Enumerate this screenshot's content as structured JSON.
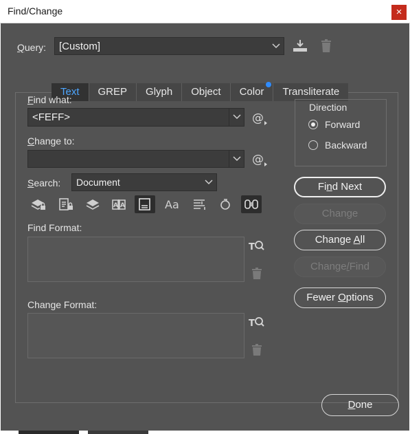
{
  "window": {
    "title": "Find/Change",
    "close_glyph": "×"
  },
  "query": {
    "label_prefix": "",
    "label_key": "Q",
    "label_rest": "uery:",
    "value": "[Custom]"
  },
  "tabs": [
    {
      "label": "Text",
      "active": true
    },
    {
      "label": "GREP"
    },
    {
      "label": "Glyph"
    },
    {
      "label": "Object"
    },
    {
      "label": "Color",
      "indicator": true
    },
    {
      "label": "Transliterate"
    }
  ],
  "find_what": {
    "label_key": "F",
    "label_rest": "ind what:",
    "value": "<FEFF>"
  },
  "change_to": {
    "label_key": "C",
    "label_rest": "hange to:",
    "value": ""
  },
  "search": {
    "label_key": "S",
    "label_rest": "earch:",
    "value": "Document"
  },
  "find_format": {
    "label": "Find Format:"
  },
  "change_format": {
    "label": "Change Format:"
  },
  "direction": {
    "title": "Direction",
    "options": [
      {
        "label": "Forward",
        "checked": true
      },
      {
        "label": "Backward",
        "checked": false
      }
    ]
  },
  "buttons": {
    "find_next": {
      "pre": "Fi",
      "key": "n",
      "post": "d Next"
    },
    "change": {
      "pre": "Chan",
      "key": "g",
      "post": "e"
    },
    "change_all": {
      "pre": "Change ",
      "key": "A",
      "post": "ll"
    },
    "change_find": {
      "pre": "Change",
      "key": "/",
      "post": "Find"
    },
    "fewer_options": {
      "pre": "Fewer ",
      "key": "O",
      "post": "ptions"
    },
    "done": {
      "pre": "",
      "key": "D",
      "post": "one"
    }
  },
  "search_option_icons": [
    "include-locked-layers-icon",
    "include-locked-stories-icon",
    "include-hidden-layers-icon",
    "include-master-pages-icon",
    "include-footnotes-icon",
    "case-sensitive-icon",
    "whole-word-icon",
    "kana-sensitive-icon",
    "full-half-width-icon"
  ],
  "colors": {
    "dialog_bg": "#535353",
    "field_bg": "#3c3c3c",
    "active_tab_text": "#4da6ff",
    "indicator_dot": "#2f8cff",
    "close_button": "#c42b1c"
  }
}
